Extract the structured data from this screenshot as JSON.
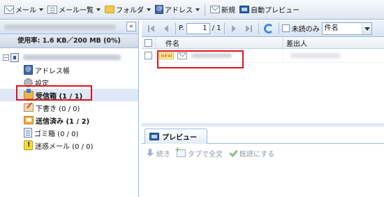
{
  "toolbar": {
    "mail_label": "メール",
    "mail_list_label": "メール一覧",
    "folder_label": "フォルダ",
    "address_label": "アドレス",
    "new_label": "新規",
    "auto_preview_label": "自動プレビュー"
  },
  "sidebar": {
    "usage": "使用率: 1.6 KB／200 MB (0%)",
    "collapse_glyph": "«",
    "expander_glyph": "−",
    "items": [
      {
        "label": "アドレス帳",
        "icon": "address-book-icon"
      },
      {
        "label": "設定",
        "icon": "gear-icon"
      },
      {
        "label": "受信箱 (1 / 1)",
        "icon": "inbox-icon",
        "bold": true,
        "selected": true
      },
      {
        "label": "下書き (0 / 0)",
        "icon": "draft-icon"
      },
      {
        "label": "送信済み (1 / 2)",
        "icon": "sent-icon",
        "bold": true
      },
      {
        "label": "ゴミ箱 (0 / 0)",
        "icon": "trash-icon"
      },
      {
        "label": "迷惑メール (0 / 0)",
        "icon": "spam-icon"
      }
    ]
  },
  "pager": {
    "page_prefix": "P.",
    "page_value": "1",
    "page_total": "/ 1",
    "unread_only_label": "未読のみ",
    "sort_value": "件名"
  },
  "grid": {
    "columns": [
      "件名",
      "差出人"
    ],
    "rows": [
      {
        "badge": "NEW"
      }
    ]
  },
  "preview": {
    "tab_label": "プレビュー",
    "actions": [
      "続き",
      "タブで全文",
      "既読にする"
    ]
  },
  "colors": {
    "highlight": "#e0141b",
    "accent": "#99bbe8"
  }
}
